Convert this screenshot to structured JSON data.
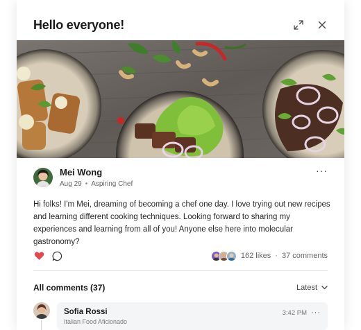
{
  "modal": {
    "title": "Hello everyone!"
  },
  "post": {
    "author_name": "Mei Wong",
    "date": "Aug 29",
    "separator": "•",
    "role": "Aspiring Chef",
    "more_label": "···",
    "body": "Hi folks! I'm Mei, dreaming of becoming a chef one day. I love trying out new recipes and learning different cooking techniques. Looking forward to sharing my experiences and learning from all of you! Anyone else here into molecular gastronomy?",
    "liked": true,
    "like_color": "#e5484d",
    "likes_text": "162 likes",
    "stats_separator": "·",
    "comments_text": "37 comments"
  },
  "comments": {
    "header": "All comments (37)",
    "sort_label": "Latest",
    "items": [
      {
        "name": "Sofia Rossi",
        "role": "Italian Food Aficionado",
        "time": "3:42 PM",
        "more_label": "···"
      }
    ]
  },
  "icons": {
    "expand": "expand-icon",
    "close": "close-icon",
    "heart": "heart-icon",
    "comment": "comment-icon",
    "chevron": "chevron-down-icon"
  }
}
